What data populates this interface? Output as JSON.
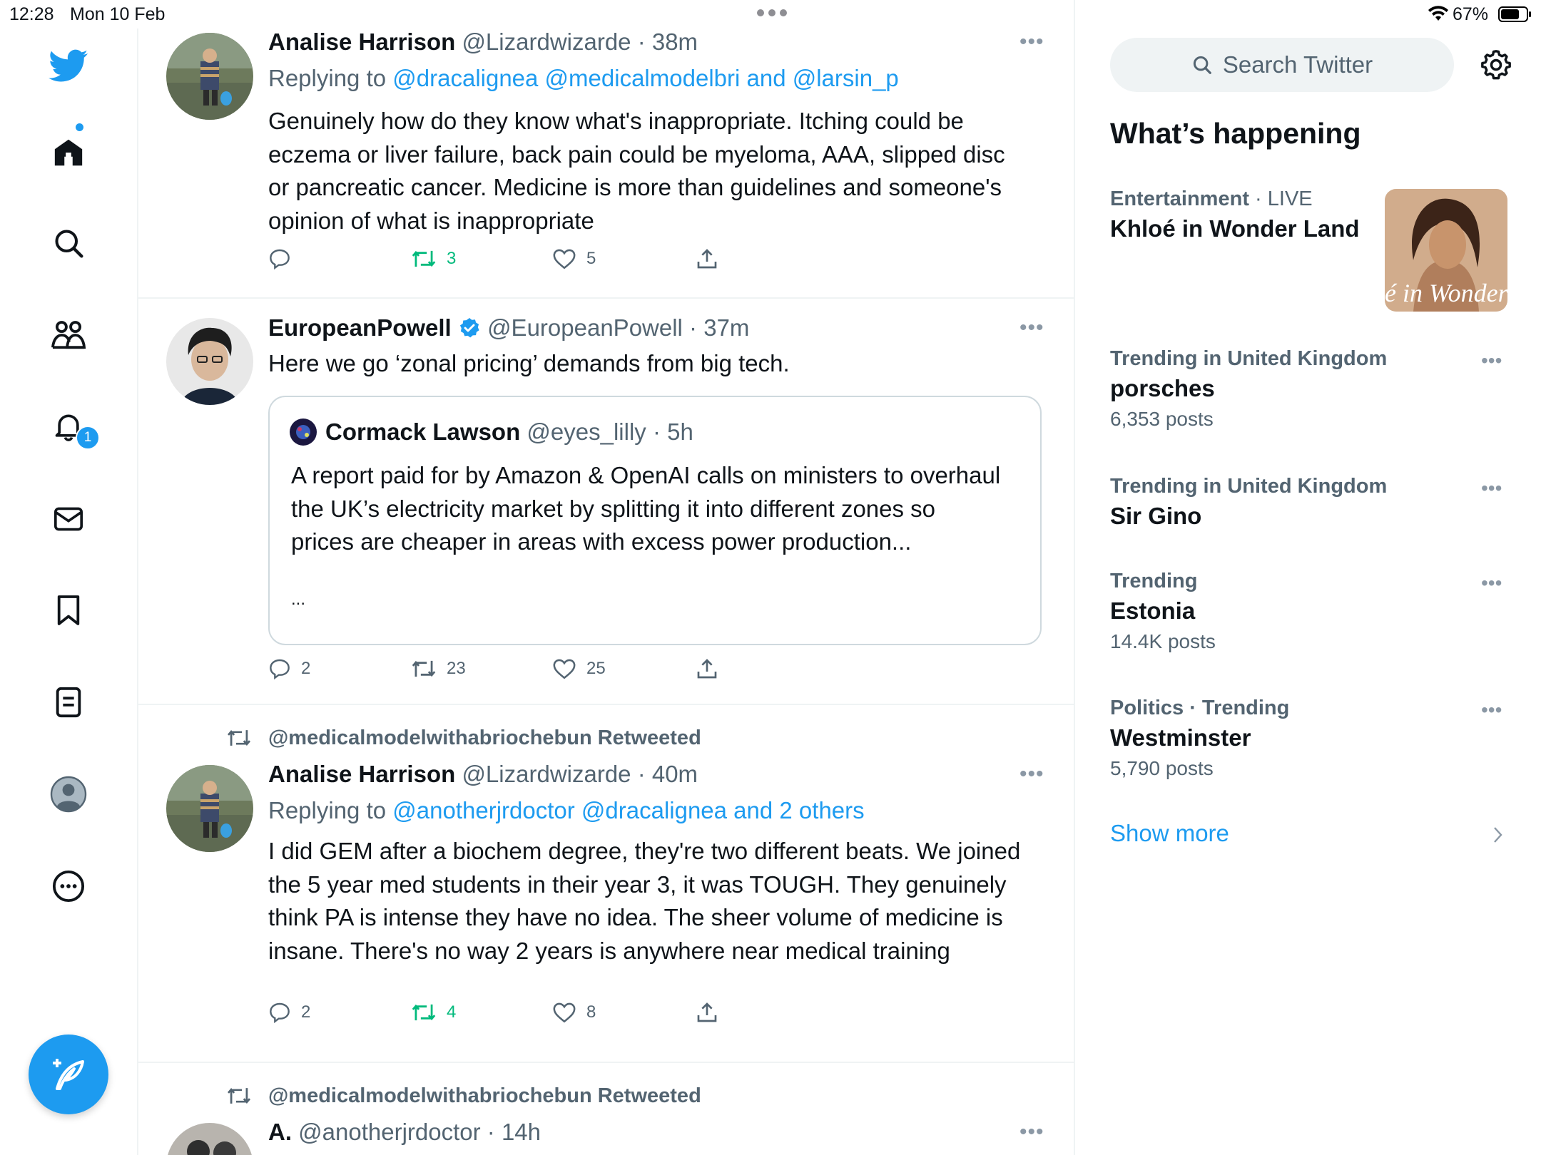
{
  "status_bar": {
    "time": "12:28",
    "date": "Mon 10 Feb",
    "battery": "67%"
  },
  "nav": {
    "items": [
      {
        "icon": "twitter-bird-icon"
      },
      {
        "icon": "home-icon"
      },
      {
        "icon": "search-icon"
      },
      {
        "icon": "communities-icon"
      },
      {
        "icon": "notifications-icon"
      },
      {
        "icon": "messages-icon"
      },
      {
        "icon": "bookmarks-icon"
      },
      {
        "icon": "lists-icon"
      },
      {
        "icon": "profile-icon"
      },
      {
        "icon": "more-icon"
      }
    ],
    "notifications_badge": "1",
    "compose_icon": "compose-icon"
  },
  "timeline": {
    "tweets": [
      {
        "name": "Analise Harrison",
        "handle": "@Lizardwizarde · 38m",
        "replying_prefix": "Replying to ",
        "replying_to": "@dracalignea @medicalmodelbri and @larsin_p",
        "text": "Genuinely how do they know what's inappropriate. Itching could be eczema or liver failure, back pain could be myeloma, AAA, slipped disc or pancreatic cancer. Medicine is more than guidelines and someone's opinion of what is inappropriate",
        "replies": "",
        "retweets": "3",
        "likes": "5"
      },
      {
        "name": "EuropeanPowell",
        "handle": "@EuropeanPowell · 37m",
        "text": "Here we go ‘zonal pricing’ demands from big tech.",
        "quote": {
          "name": "Cormack Lawson",
          "handle": "@eyes_lilly · 5h",
          "text": "A report paid for by Amazon & OpenAI calls on ministers to overhaul the UK’s electricity market by splitting it into different zones so prices are cheaper in areas with excess power production...",
          "ellipsis": "..."
        },
        "replies": "2",
        "retweets": "23",
        "likes": "25"
      },
      {
        "retweeted_by": "@medicalmodelwithabriochebun Retweeted",
        "name": "Analise Harrison",
        "handle": "@Lizardwizarde · 40m",
        "replying_prefix": "Replying to ",
        "replying_to": "@anotherjrdoctor @dracalignea and 2 others",
        "text": "I did GEM after a biochem degree, they're two different beats. We joined the 5 year med students in their year 3, it was TOUGH. They genuinely think PA is intense they have no idea. The sheer volume of medicine is insane. There's no way 2 years is anywhere near medical training",
        "replies": "2",
        "retweets": "4",
        "likes": "8"
      },
      {
        "retweeted_by": "@medicalmodelwithabriochebun Retweeted",
        "name": "A.",
        "handle": "@anotherjrdoctor · 14h"
      }
    ]
  },
  "sidebar": {
    "search_placeholder": "Search Twitter",
    "heading": "What’s happening",
    "trends": [
      {
        "category": "Entertainment",
        "category_extra": " · LIVE",
        "title": "Khloé in Wonder Land",
        "count": "",
        "image_text": "é in Wonder L"
      },
      {
        "category": "Trending in United Kingdom",
        "title": "porsches",
        "count": "6,353 posts"
      },
      {
        "category": "Trending in United Kingdom",
        "title": "Sir Gino",
        "count": ""
      },
      {
        "category": "Trending",
        "title": "Estonia",
        "count": "14.4K posts"
      },
      {
        "category": "Politics · Trending",
        "title": "Westminster",
        "count": "5,790 posts"
      }
    ],
    "show_more": "Show more"
  },
  "colors": {
    "accent": "#1d9bf0",
    "retweet_green": "#00ba7c",
    "muted": "#536471"
  }
}
